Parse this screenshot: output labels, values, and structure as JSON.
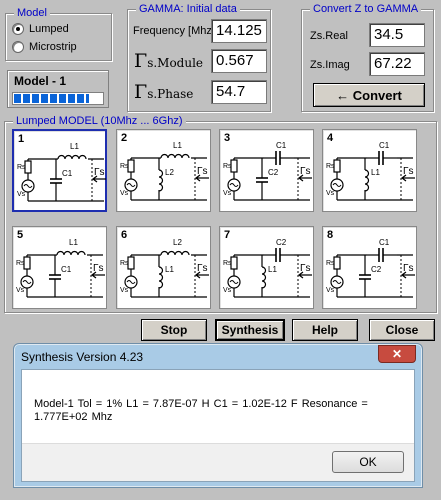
{
  "model_group": {
    "title": "Model",
    "options": [
      "Lumped",
      "Microstrip"
    ],
    "selected": "Lumped"
  },
  "model_status": {
    "label": "Model - 1",
    "progress": 0.85
  },
  "gamma_group": {
    "title": "GAMMA: Initial data",
    "frequency_label": "Frequency [Mhz]",
    "frequency_value": "14.125",
    "module_symbol": "Γ",
    "module_sub": "s.Module",
    "module_value": "0.567",
    "phase_symbol": "Γ",
    "phase_sub": "s.Phase",
    "phase_value": "54.7"
  },
  "convert_group": {
    "title": "Convert Z to GAMMA",
    "zreal_label": "Zs.Real",
    "zreal_value": "34.5",
    "zimag_label": "Zs.Imag",
    "zimag_value": "67.22",
    "convert_label": "← Convert"
  },
  "lumped_group": {
    "title": "Lumped MODEL  (10Mhz ... 6Ghz)",
    "selected_model": "1",
    "cards": [
      {
        "num": "1",
        "top_label": "L1",
        "mid_label": "C1",
        "src_labels": [
          "Rs",
          "Vs"
        ],
        "gamma": "Γs"
      },
      {
        "num": "2",
        "top_label": "L1",
        "mid_label": "L2",
        "src_labels": [
          "Rs",
          "Vs"
        ],
        "gamma": "Γs"
      },
      {
        "num": "3",
        "top_label": "C1",
        "mid_label": "C2",
        "src_labels": [
          "Rs",
          "Vs"
        ],
        "gamma": "Γs"
      },
      {
        "num": "4",
        "top_label": "C1",
        "mid_label": "L1",
        "src_labels": [
          "Rs",
          "Vs"
        ],
        "gamma": "Γs"
      },
      {
        "num": "5",
        "top_label": "L1",
        "mid_label": "C1",
        "src_labels": [
          "Rs",
          "Vs"
        ],
        "gamma": "Γs"
      },
      {
        "num": "6",
        "top_label": "L2",
        "mid_label": "L1",
        "src_labels": [
          "Rs",
          "Vs"
        ],
        "gamma": "Γs"
      },
      {
        "num": "7",
        "top_label": "C2",
        "mid_label": "L1",
        "src_labels": [
          "Rs",
          "Vs"
        ],
        "gamma": "Γs"
      },
      {
        "num": "8",
        "top_label": "C1",
        "mid_label": "C2",
        "src_labels": [
          "Rs",
          "Vs"
        ],
        "gamma": "Γs"
      }
    ]
  },
  "actions": {
    "stop": "Stop",
    "synthesis": "Synthesis",
    "help": "Help",
    "close": "Close"
  },
  "dialog": {
    "title": "Synthesis Version 4.23",
    "close_glyph": "✕",
    "message": "Model-1    Tol = 1%    L1 = 7.87E-07 H       C1 = 1.02E-12 F   Resonance = 1.777E+02 Mhz",
    "ok_label": "OK"
  }
}
